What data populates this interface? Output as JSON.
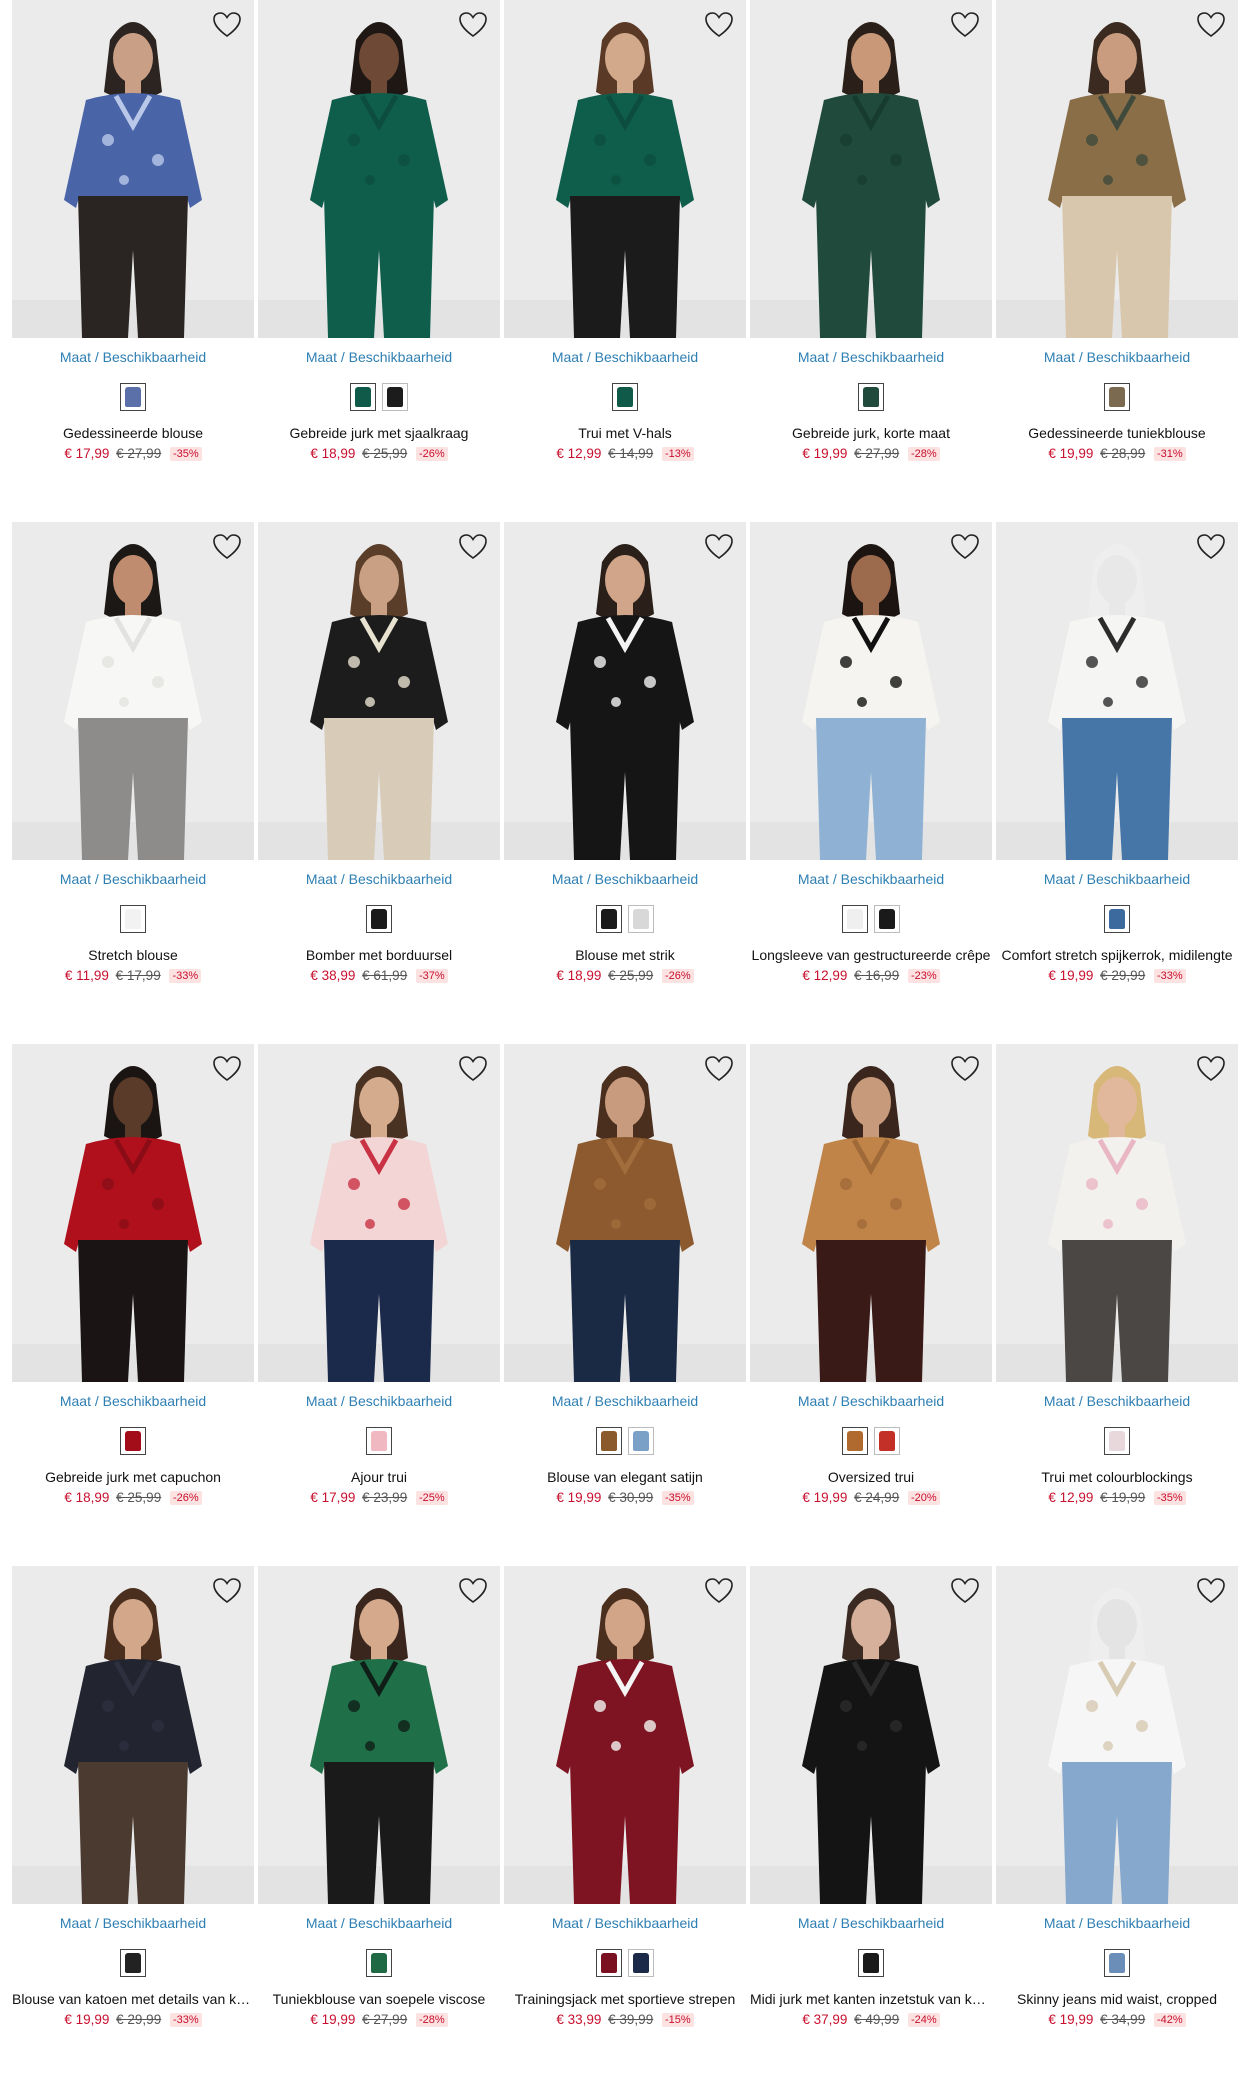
{
  "colors": {
    "link": "#2e7fb3",
    "sale_price": "#c8102e",
    "discount_bg": "#fde2e2"
  },
  "products": [
    {
      "maat": "Maat / Beschikbaarheid",
      "name": "Gedessineerde blouse",
      "price": "€ 17,99",
      "old": "€ 27,99",
      "disc": "-35%",
      "swatches": [
        "#5b6fa8"
      ],
      "palette": {
        "top": "#4a64a8",
        "accent": "#b9c8e8",
        "bottom": "#2a2522",
        "skin": "#c99f86",
        "hair": "#2b2420"
      }
    },
    {
      "maat": "Maat / Beschikbaarheid",
      "name": "Gebreide jurk met sjaalkraag",
      "price": "€ 18,99",
      "old": "€ 25,99",
      "disc": "-26%",
      "swatches": [
        "#0f5a48",
        "#1c1c1c"
      ],
      "palette": {
        "top": "#0f5e4c",
        "accent": "#0c4d3e",
        "bottom": "#0f5e4c",
        "skin": "#6e4a36",
        "hair": "#1e1714"
      }
    },
    {
      "maat": "Maat / Beschikbaarheid",
      "name": "Trui met V-hals",
      "price": "€ 12,99",
      "old": "€ 14,99",
      "disc": "-13%",
      "swatches": [
        "#0f5a48"
      ],
      "palette": {
        "top": "#0f5e4c",
        "accent": "#0c4d3e",
        "bottom": "#1b1b1b",
        "skin": "#d3a98c",
        "hair": "#5a3a26"
      }
    },
    {
      "maat": "Maat / Beschikbaarheid",
      "name": "Gebreide jurk, korte maat",
      "price": "€ 19,99",
      "old": "€ 27,99",
      "disc": "-28%",
      "swatches": [
        "#1f4a3c"
      ],
      "palette": {
        "top": "#1f4a3c",
        "accent": "#183b30",
        "bottom": "#1f4a3c",
        "skin": "#c89878",
        "hair": "#2b2019"
      }
    },
    {
      "maat": "Maat / Beschikbaarheid",
      "name": "Gedessineerde tuniekblouse",
      "price": "€ 19,99",
      "old": "€ 28,99",
      "disc": "-31%",
      "swatches": [
        "#7b6a4f"
      ],
      "palette": {
        "top": "#8a6e48",
        "accent": "#3f4a3c",
        "bottom": "#d8c7ad",
        "skin": "#c99c80",
        "hair": "#3b2a20"
      }
    },
    {
      "maat": "Maat / Beschikbaarheid",
      "name": "Stretch blouse",
      "price": "€ 11,99",
      "old": "€ 17,99",
      "disc": "-33%",
      "swatches": [
        "#f2f2f2"
      ],
      "palette": {
        "top": "#f7f7f5",
        "accent": "#e2e2e0",
        "bottom": "#8d8c8a",
        "skin": "#c08c70",
        "hair": "#1c1816"
      }
    },
    {
      "maat": "Maat / Beschikbaarheid",
      "name": "Bomber met borduursel",
      "price": "€ 38,99",
      "old": "€ 61,99",
      "disc": "-37%",
      "swatches": [
        "#1a1a1a"
      ],
      "palette": {
        "top": "#1c1c1c",
        "accent": "#e8e2d0",
        "bottom": "#d8cbb8",
        "skin": "#caa084",
        "hair": "#5b3e2a"
      }
    },
    {
      "maat": "Maat / Beschikbaarheid",
      "name": "Blouse met strik",
      "price": "€ 18,99",
      "old": "€ 25,99",
      "disc": "-26%",
      "swatches": [
        "#1a1a1a",
        "#d8d8d8"
      ],
      "palette": {
        "top": "#151515",
        "accent": "#f4f4f4",
        "bottom": "#151515",
        "skin": "#d0a58a",
        "hair": "#2a1f19"
      }
    },
    {
      "maat": "Maat / Beschikbaarheid",
      "name": "Longsleeve van gestructureerde crêpe",
      "price": "€ 12,99",
      "old": "€ 16,99",
      "disc": "-23%",
      "swatches": [
        "#efefef",
        "#1a1a1a"
      ],
      "palette": {
        "top": "#f6f4f0",
        "accent": "#111111",
        "bottom": "#8fb2d4",
        "skin": "#9c6a4c",
        "hair": "#1c1410"
      }
    },
    {
      "maat": "Maat / Beschikbaarheid",
      "name": "Comfort stretch spijkerrok, midilengte",
      "price": "€ 19,99",
      "old": "€ 29,99",
      "disc": "-33%",
      "swatches": [
        "#3c6a9e"
      ],
      "palette": {
        "top": "#f5f5f3",
        "accent": "#2c2c2c",
        "bottom": "#4676a8",
        "skin": "#e8e8e8",
        "hair": "#eeeeee"
      }
    },
    {
      "maat": "Maat / Beschikbaarheid",
      "name": "Gebreide jurk met capuchon",
      "price": "€ 18,99",
      "old": "€ 25,99",
      "disc": "-26%",
      "swatches": [
        "#a30d1a"
      ],
      "palette": {
        "top": "#b0101c",
        "accent": "#8a0c16",
        "bottom": "#1a1414",
        "skin": "#5a3a28",
        "hair": "#1a1412"
      }
    },
    {
      "maat": "Maat / Beschikbaarheid",
      "name": "Ajour trui",
      "price": "€ 17,99",
      "old": "€ 23,99",
      "disc": "-25%",
      "swatches": [
        "#f0b8c0"
      ],
      "palette": {
        "top": "#f3d5d5",
        "accent": "#c93245",
        "bottom": "#1b2a4a",
        "skin": "#d5ab8e",
        "hair": "#4a3222"
      }
    },
    {
      "maat": "Maat / Beschikbaarheid",
      "name": "Blouse van elegant satijn",
      "price": "€ 19,99",
      "old": "€ 30,99",
      "disc": "-35%",
      "swatches": [
        "#8a5a2c",
        "#7aa0c8"
      ],
      "palette": {
        "top": "#8c5a2e",
        "accent": "#a16d3c",
        "bottom": "#1a2a44",
        "skin": "#c99b7e",
        "hair": "#4a2e1e"
      }
    },
    {
      "maat": "Maat / Beschikbaarheid",
      "name": "Oversized trui",
      "price": "€ 19,99",
      "old": "€ 24,99",
      "disc": "-20%",
      "swatches": [
        "#b06a30",
        "#c23028"
      ],
      "palette": {
        "top": "#c08448",
        "accent": "#a06a38",
        "bottom": "#3a1a16",
        "skin": "#c79a7c",
        "hair": "#3a261c"
      }
    },
    {
      "maat": "Maat / Beschikbaarheid",
      "name": "Trui met colourblockings",
      "price": "€ 12,99",
      "old": "€ 19,99",
      "disc": "-35%",
      "swatches": [
        "#e8d8dc"
      ],
      "palette": {
        "top": "#f3f1ee",
        "accent": "#e8b6c4",
        "bottom": "#4a4744",
        "skin": "#e2b89c",
        "hair": "#d8b878"
      }
    },
    {
      "maat": "Maat / Beschikbaarheid",
      "name": "Blouse van katoen met details van kant",
      "price": "€ 19,99",
      "old": "€ 29,99",
      "disc": "-33%",
      "swatches": [
        "#222222"
      ],
      "palette": {
        "top": "#222430",
        "accent": "#2e3040",
        "bottom": "#4a3a30",
        "skin": "#d2a78a",
        "hair": "#4a2e1e"
      }
    },
    {
      "maat": "Maat / Beschikbaarheid",
      "name": "Tuniekblouse van soepele viscose",
      "price": "€ 19,99",
      "old": "€ 27,99",
      "disc": "-28%",
      "swatches": [
        "#1f6a44"
      ],
      "palette": {
        "top": "#1f7048",
        "accent": "#0f1f18",
        "bottom": "#1a1a1a",
        "skin": "#d4a98c",
        "hair": "#3a261c"
      }
    },
    {
      "maat": "Maat / Beschikbaarheid",
      "name": "Trainingsjack met sportieve strepen",
      "price": "€ 33,99",
      "old": "€ 39,99",
      "disc": "-15%",
      "swatches": [
        "#7a1020",
        "#1c2a4a"
      ],
      "palette": {
        "top": "#7e1422",
        "accent": "#f4f4f4",
        "bottom": "#7e1422",
        "skin": "#d2a488",
        "hair": "#4a2e1e"
      }
    },
    {
      "maat": "Maat / Beschikbaarheid",
      "name": "Midi jurk met kanten inzetstuk van katoen",
      "price": "€ 37,99",
      "old": "€ 49,99",
      "disc": "-24%",
      "swatches": [
        "#1a1a1a"
      ],
      "palette": {
        "top": "#141414",
        "accent": "#2a2a2a",
        "bottom": "#141414",
        "skin": "#d6b09a",
        "hair": "#3a2a22"
      }
    },
    {
      "maat": "Maat / Beschikbaarheid",
      "name": "Skinny jeans mid waist, cropped",
      "price": "€ 19,99",
      "old": "€ 34,99",
      "disc": "-42%",
      "swatches": [
        "#6a8eb8"
      ],
      "palette": {
        "top": "#f6f6f6",
        "accent": "#d8cbb4",
        "bottom": "#86a8cc",
        "skin": "#e4e4e4",
        "hair": "#eeeeee"
      }
    }
  ]
}
